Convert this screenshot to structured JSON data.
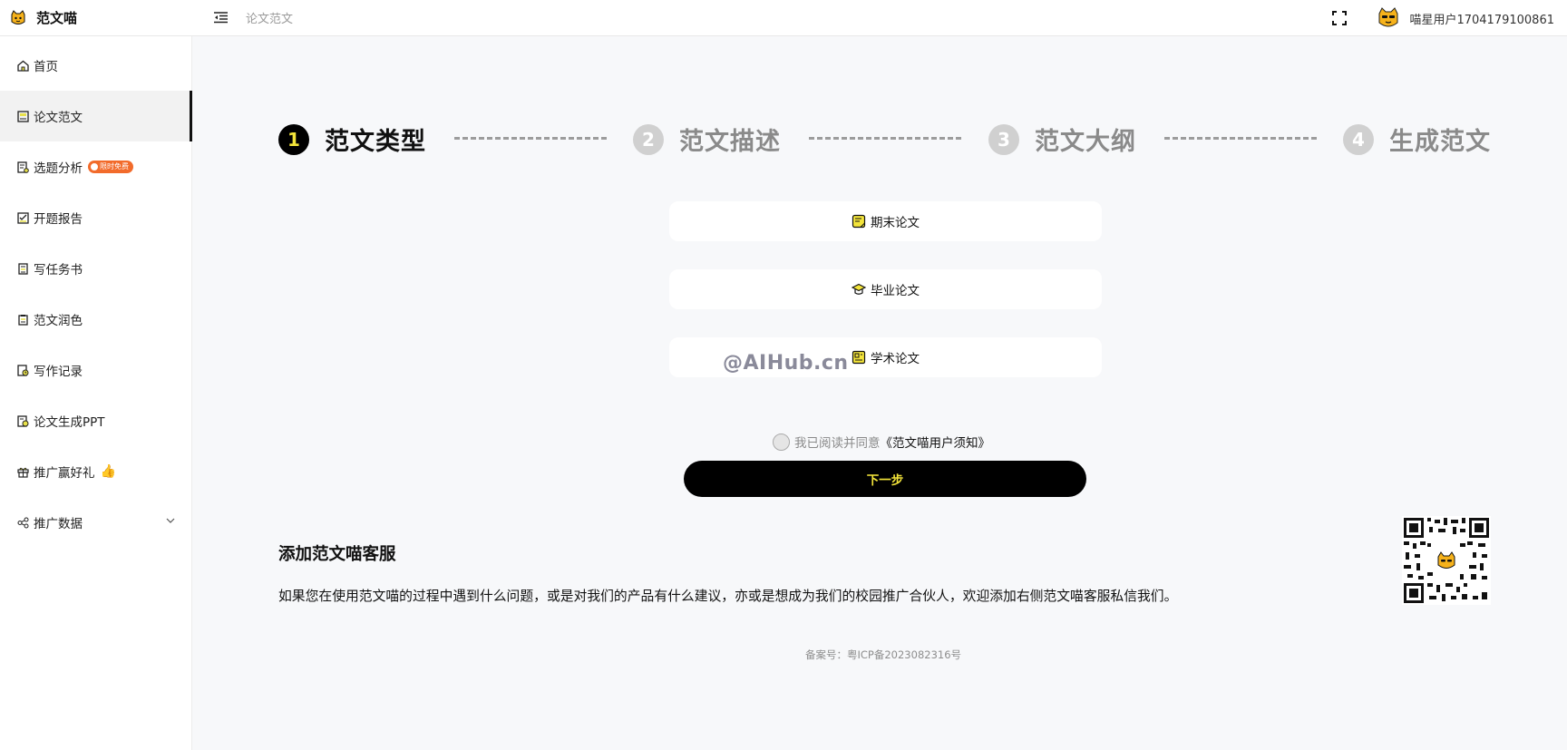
{
  "header": {
    "app_name": "范文喵",
    "breadcrumb": "论文范文",
    "username": "喵星用户1704179100861"
  },
  "sidebar": {
    "items": [
      {
        "label": "首页",
        "icon": "home-icon"
      },
      {
        "label": "论文范文",
        "icon": "document-icon",
        "active": true
      },
      {
        "label": "选题分析",
        "icon": "topic-icon",
        "badge": "限时免费"
      },
      {
        "label": "开题报告",
        "icon": "checklist-icon"
      },
      {
        "label": "写任务书",
        "icon": "task-icon"
      },
      {
        "label": "范文润色",
        "icon": "polish-icon"
      },
      {
        "label": "写作记录",
        "icon": "history-icon"
      },
      {
        "label": "论文生成PPT",
        "icon": "ppt-icon"
      },
      {
        "label": "推广赢好礼",
        "icon": "gift-icon",
        "emoji": "👍"
      },
      {
        "label": "推广数据",
        "icon": "share-icon",
        "expandable": true
      }
    ]
  },
  "steps": [
    {
      "num": "1",
      "label": "范文类型",
      "active": true
    },
    {
      "num": "2",
      "label": "范文描述",
      "active": false
    },
    {
      "num": "3",
      "label": "范文大纲",
      "active": false
    },
    {
      "num": "4",
      "label": "生成范文",
      "active": false
    }
  ],
  "options": [
    {
      "label": "期末论文",
      "icon": "note-icon"
    },
    {
      "label": "毕业论文",
      "icon": "graduation-cap-icon"
    },
    {
      "label": "学术论文",
      "icon": "academic-icon"
    }
  ],
  "watermark": "@AIHub.cn",
  "agreement": {
    "text": "我已阅读并同意",
    "link": "《范文喵用户须知》"
  },
  "next_button": "下一步",
  "support": {
    "title": "添加范文喵客服",
    "description": "如果您在使用范文喵的过程中遇到什么问题，或是对我们的产品有什么建议，亦或是想成为我们的校园推广合伙人，欢迎添加右侧范文喵客服私信我们。"
  },
  "footer": {
    "icp": "备案号：粤ICP备2023082316号"
  },
  "colors": {
    "accent_yellow": "#f3e43a",
    "badge_orange": "#f26b2b",
    "background": "#f7f8fa"
  }
}
